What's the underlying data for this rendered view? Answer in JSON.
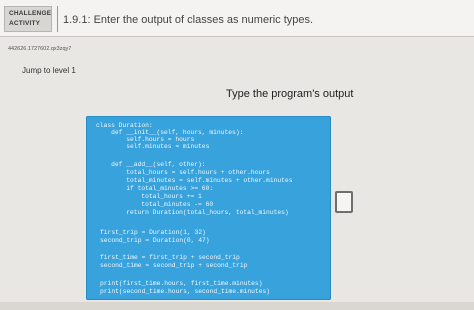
{
  "activity": {
    "badge_line1": "CHALLENGE",
    "badge_line2": "ACTIVITY",
    "title": "1.9.1: Enter the output of classes as numeric types.",
    "id": "442626.1727602.qx3zqy7",
    "jump_label": "Jump to level 1"
  },
  "task": {
    "label": "Type the program's output"
  },
  "code": {
    "lines": [
      "class Duration:",
      "    def __init__(self, hours, minutes):",
      "        self.hours = hours",
      "        self.minutes = minutes",
      "",
      "    def __add__(self, other):",
      "        total_hours = self.hours + other.hours",
      "        total_minutes = self.minutes + other.minutes",
      "        if total_minutes >= 60:",
      "            total_hours += 1",
      "            total_minutes -= 60",
      "        return Duration(total_hours, total_minutes)",
      "",
      "first_trip = Duration(1, 32)",
      "second_trip = Duration(0, 47)",
      "",
      "first_time = first_trip + second_trip",
      "second_time = second_trip + second_trip",
      "",
      "print(first_time.hours, first_time.minutes)",
      "print(second_time.hours, second_time.minutes)"
    ]
  },
  "answer": {
    "value": ""
  },
  "colors": {
    "code_bg": "#38a2dd",
    "code_text": "#f2f7fb",
    "page_bg": "#e9e7e3"
  }
}
